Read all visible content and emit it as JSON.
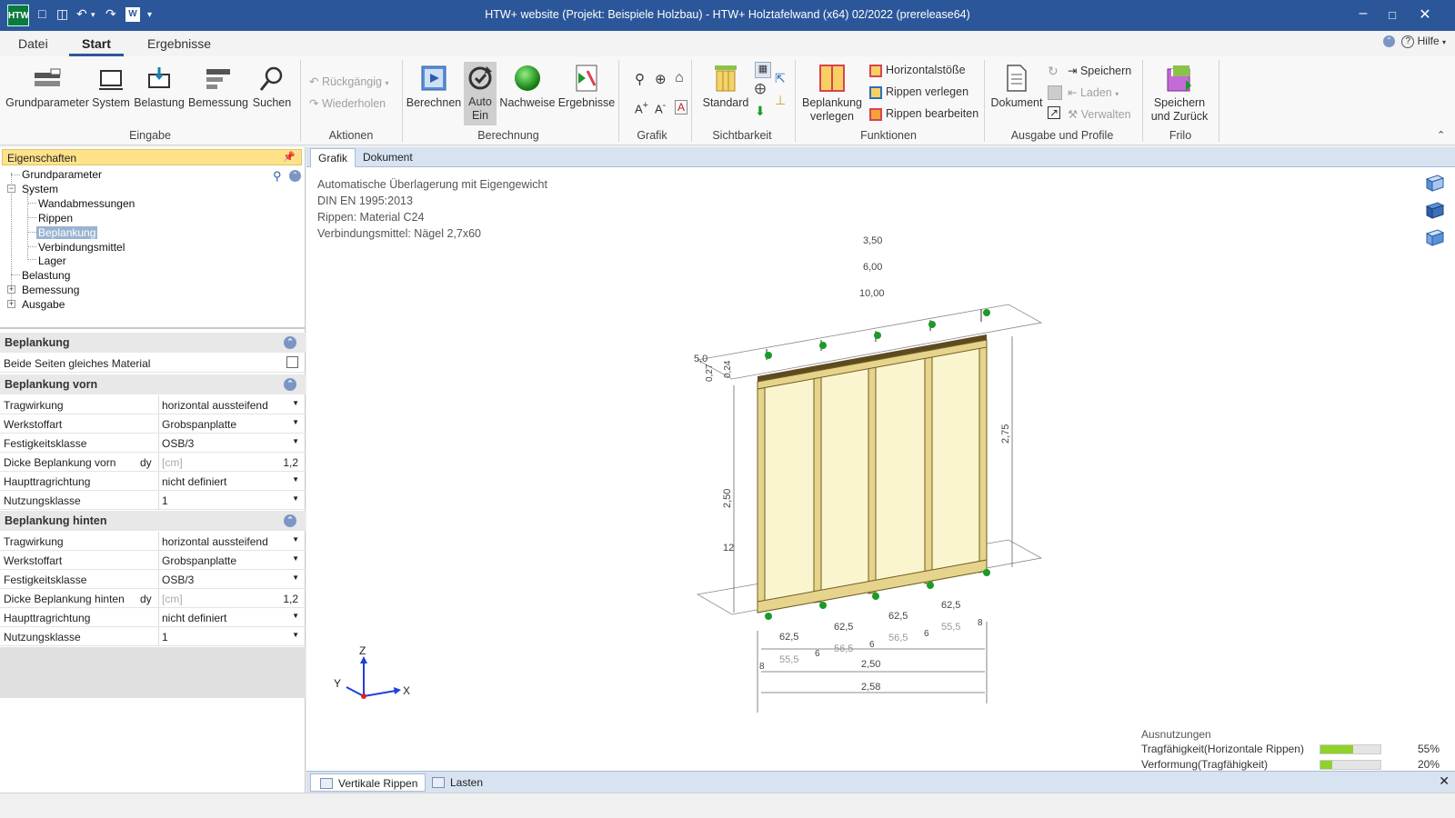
{
  "titlebar": {
    "title": "HTW+ website (Projekt: Beispiele Holzbau) - HTW+ Holztafelwand (x64) 02/2022  (prerelease64)",
    "app_icon": "HTW"
  },
  "tabs": {
    "datei": "Datei",
    "start": "Start",
    "ergebnisse": "Ergebnisse",
    "help": "Hilfe"
  },
  "ribbon": {
    "eingabe": {
      "label": "Eingabe",
      "grundparameter": "Grundparameter",
      "system": "System",
      "belastung": "Belastung",
      "bemessung": "Bemessung",
      "suchen": "Suchen"
    },
    "aktionen": {
      "label": "Aktionen",
      "undo": "Rückgängig",
      "redo": "Wiederholen"
    },
    "berechnung": {
      "label": "Berechnung",
      "berechnen": "Berechnen",
      "auto": "Auto",
      "ein": "Ein",
      "nachweise": "Nachweise",
      "ergebnisse": "Ergebnisse"
    },
    "grafik": {
      "label": "Grafik"
    },
    "sichtbarkeit": {
      "label": "Sichtbarkeit",
      "standard": "Standard"
    },
    "funktionen": {
      "label": "Funktionen",
      "beplankung_1": "Beplankung",
      "beplankung_2": "verlegen",
      "horizontalstoesse": "Horizontalstöße",
      "rippen_verlegen": "Rippen verlegen",
      "rippen_bearbeiten": "Rippen bearbeiten"
    },
    "ausgabe": {
      "label": "Ausgabe und Profile",
      "dokument": "Dokument",
      "speichern": "Speichern",
      "laden": "Laden",
      "verwalten": "Verwalten"
    },
    "frilo": {
      "label": "Frilo",
      "save_back_1": "Speichern",
      "save_back_2": "und Zurück"
    }
  },
  "props_panel": {
    "title": "Eigenschaften",
    "tree": {
      "grundparameter": "Grundparameter",
      "system": "System",
      "wandabmessungen": "Wandabmessungen",
      "rippen": "Rippen",
      "beplankung": "Beplankung",
      "verbindungsmittel": "Verbindungsmittel",
      "lager": "Lager",
      "belastung": "Belastung",
      "bemessung": "Bemessung",
      "ausgabe": "Ausgabe"
    },
    "sec_beplankung": "Beplankung",
    "beide_seiten": "Beide Seiten gleiches Material",
    "sec_vorn": "Beplankung vorn",
    "sec_hinten": "Beplankung hinten",
    "labels": {
      "tragwirkung": "Tragwirkung",
      "werkstoffart": "Werkstoffart",
      "festigkeitsklasse": "Festigkeitsklasse",
      "dicke_vorn": "Dicke Beplankung vorn",
      "dicke_hinten": "Dicke Beplankung hinten",
      "haupttragrichtung": "Haupttragrichtung",
      "nutzungsklasse": "Nutzungsklasse",
      "dy": "dy",
      "unit_cm": "[cm]"
    },
    "vorn": {
      "tragwirkung": "horizontal aussteifend",
      "werkstoffart": "Grobspanplatte",
      "festigkeitsklasse": "OSB/3",
      "dicke": "1,2",
      "haupttragrichtung": "nicht definiert",
      "nutzungsklasse": "1"
    },
    "hinten": {
      "tragwirkung": "horizontal aussteifend",
      "werkstoffart": "Grobspanplatte",
      "festigkeitsklasse": "OSB/3",
      "dicke": "1,2",
      "haupttragrichtung": "nicht definiert",
      "nutzungsklasse": "1"
    }
  },
  "doc_tabs": {
    "grafik": "Grafik",
    "dokument": "Dokument"
  },
  "canvas": {
    "info": [
      "Automatische Überlagerung mit Eigengewicht",
      "DIN EN 1995:2013",
      "Rippen: Material C24",
      "Verbindungsmittel: Nägel 2,7x60"
    ],
    "loads": [
      "3,50",
      "6,00",
      "10,00"
    ],
    "dims": {
      "top_a": "5,0",
      "top_b": "0,27",
      "top_c": "0,24",
      "h_left": "2,50",
      "h_right": "2,75",
      "small_12": "12",
      "spans_top": [
        "62,5",
        "62,5",
        "62,5",
        "62,5"
      ],
      "spans_clear": [
        "55,5",
        "56,5",
        "56,5",
        "55,5"
      ],
      "edge_8": "8",
      "mid_6": "6",
      "width_250": "2,50",
      "width_258": "2,58"
    },
    "axes": {
      "x": "X",
      "y": "Y",
      "z": "Z"
    },
    "utilization": {
      "title": "Ausnutzungen",
      "rows": [
        {
          "label": "Tragfähigkeit(Horizontale Rippen)",
          "pct": "55%",
          "value": 0.55
        },
        {
          "label": "Verformung(Tragfähigkeit)",
          "pct": "20%",
          "value": 0.2
        }
      ]
    }
  },
  "bottom_tabs": {
    "vertikale": "Vertikale Rippen",
    "lasten": "Lasten"
  },
  "colors": {
    "titlebar": "#2b579a",
    "panel_head": "#fde28a",
    "wood": "#f3e9a6",
    "load_red": "#d9434f",
    "load_teal": "#3aa39a",
    "support_green": "#1b9a2a",
    "util_fill": "#90d12c"
  }
}
